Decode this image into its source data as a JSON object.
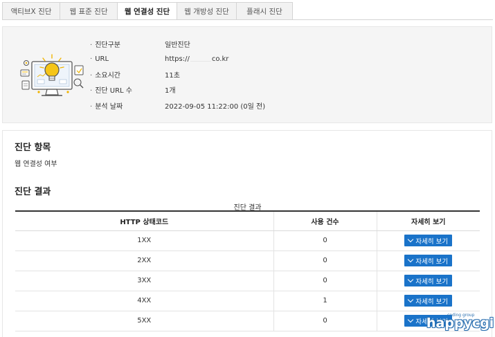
{
  "tabs": [
    {
      "label": "액티브X 진단",
      "active": false
    },
    {
      "label": "웹 표준 진단",
      "active": false
    },
    {
      "label": "웹 연결성 진단",
      "active": true
    },
    {
      "label": "웹 개방성 진단",
      "active": false
    },
    {
      "label": "플래시 진단",
      "active": false
    }
  ],
  "summary": {
    "rows": [
      {
        "key": "진단구분",
        "value": "일반진단"
      },
      {
        "key": "URL",
        "value_prefix": "https://",
        "value_suffix": "co.kr"
      },
      {
        "key": "소요시간",
        "value": "11초"
      },
      {
        "key": "진단 URL 수",
        "value": "1개"
      },
      {
        "key": "분석 날짜",
        "value": "2022-09-05 11:22:00 (0일 전)"
      }
    ],
    "illustration_icon": "lightbulb-monitor-icon"
  },
  "items_section": {
    "title": "진단 항목",
    "text": "웹 연결성 여부"
  },
  "results_section": {
    "title": "진단 결과",
    "caption": "진단 결과",
    "columns": [
      "HTTP 상태코드",
      "사용 건수",
      "자세히 보기"
    ],
    "rows": [
      {
        "code": "1XX",
        "count": "0",
        "button": "자세히 보기"
      },
      {
        "code": "2XX",
        "count": "0",
        "button": "자세히 보기"
      },
      {
        "code": "3XX",
        "count": "0",
        "button": "자세히 보기"
      },
      {
        "code": "4XX",
        "count": "1",
        "button": "자세히 보기"
      },
      {
        "code": "5XX",
        "count": "0",
        "button": "자세히 보기"
      }
    ]
  },
  "watermark": {
    "main": "happycgi",
    "sub": "coding group"
  },
  "colors": {
    "accent": "#1a73c9",
    "tab_bg": "#f2f2f2",
    "panel_bg": "#f5f5f5",
    "bulb": "#f5c518"
  }
}
